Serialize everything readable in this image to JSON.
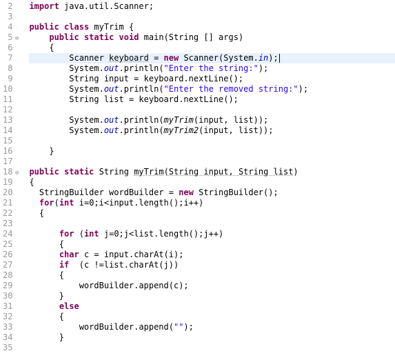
{
  "lines": [
    {
      "num": "2",
      "fold": "",
      "tokens": [
        {
          "cls": "kw",
          "t": "import"
        },
        {
          "cls": "",
          "t": " java.util.Scanner;"
        }
      ]
    },
    {
      "num": "3",
      "fold": "",
      "tokens": [
        {
          "cls": "",
          "t": ""
        }
      ]
    },
    {
      "num": "4",
      "fold": "",
      "tokens": [
        {
          "cls": "kw",
          "t": "public"
        },
        {
          "cls": "",
          "t": " "
        },
        {
          "cls": "kw",
          "t": "class"
        },
        {
          "cls": "",
          "t": " myTrim {"
        }
      ]
    },
    {
      "num": "5",
      "fold": "⊖",
      "tokens": [
        {
          "cls": "",
          "t": "    "
        },
        {
          "cls": "kw",
          "t": "public"
        },
        {
          "cls": "",
          "t": " "
        },
        {
          "cls": "kw",
          "t": "static"
        },
        {
          "cls": "",
          "t": " "
        },
        {
          "cls": "kw",
          "t": "void"
        },
        {
          "cls": "",
          "t": " main(String [] args)"
        }
      ]
    },
    {
      "num": "6",
      "fold": "",
      "tokens": [
        {
          "cls": "",
          "t": "    {"
        }
      ]
    },
    {
      "num": "7",
      "fold": "",
      "highlight": true,
      "cursor": true,
      "tokens": [
        {
          "cls": "",
          "t": "        Scanner "
        },
        {
          "cls": "underline-wavy",
          "t": "keyboard"
        },
        {
          "cls": "",
          "t": " = "
        },
        {
          "cls": "kw",
          "t": "new"
        },
        {
          "cls": "",
          "t": " Scanner(System."
        },
        {
          "cls": "field",
          "t": "in"
        },
        {
          "cls": "",
          "t": ");"
        }
      ]
    },
    {
      "num": "8",
      "fold": "",
      "tokens": [
        {
          "cls": "",
          "t": "        System."
        },
        {
          "cls": "field",
          "t": "out"
        },
        {
          "cls": "",
          "t": ".println("
        },
        {
          "cls": "str",
          "t": "\"Enter the string:\""
        },
        {
          "cls": "",
          "t": ");"
        }
      ]
    },
    {
      "num": "9",
      "fold": "",
      "tokens": [
        {
          "cls": "",
          "t": "        String input = keyboard.nextLine();"
        }
      ]
    },
    {
      "num": "10",
      "fold": "",
      "tokens": [
        {
          "cls": "",
          "t": "        System."
        },
        {
          "cls": "field",
          "t": "out"
        },
        {
          "cls": "",
          "t": ".println("
        },
        {
          "cls": "str",
          "t": "\"Enter the removed string:\""
        },
        {
          "cls": "",
          "t": ");"
        }
      ]
    },
    {
      "num": "11",
      "fold": "",
      "tokens": [
        {
          "cls": "",
          "t": "        String list = keyboard.nextLine();"
        }
      ]
    },
    {
      "num": "12",
      "fold": "",
      "tokens": [
        {
          "cls": "",
          "t": ""
        }
      ]
    },
    {
      "num": "13",
      "fold": "",
      "tokens": [
        {
          "cls": "",
          "t": "        System."
        },
        {
          "cls": "field",
          "t": "out"
        },
        {
          "cls": "",
          "t": ".println("
        },
        {
          "cls": "static-call",
          "t": "myTrim"
        },
        {
          "cls": "",
          "t": "(input, list));"
        }
      ]
    },
    {
      "num": "14",
      "fold": "",
      "tokens": [
        {
          "cls": "",
          "t": "        System."
        },
        {
          "cls": "field",
          "t": "out"
        },
        {
          "cls": "",
          "t": ".println("
        },
        {
          "cls": "static-call",
          "t": "myTrim2"
        },
        {
          "cls": "",
          "t": "(input, list));"
        }
      ]
    },
    {
      "num": "15",
      "fold": "",
      "tokens": [
        {
          "cls": "",
          "t": ""
        }
      ]
    },
    {
      "num": "16",
      "fold": "",
      "tokens": [
        {
          "cls": "",
          "t": "    }"
        }
      ]
    },
    {
      "num": "17",
      "fold": "",
      "tokens": [
        {
          "cls": "",
          "t": ""
        }
      ]
    },
    {
      "num": "18",
      "fold": "⊖",
      "tokens": [
        {
          "cls": "kw",
          "t": "public"
        },
        {
          "cls": "",
          "t": " "
        },
        {
          "cls": "kw",
          "t": "static"
        },
        {
          "cls": "",
          "t": " String "
        },
        {
          "cls": "underline-wavy",
          "t": "myTrim"
        },
        {
          "cls": "",
          "t": "("
        },
        {
          "cls": "underline-wavy",
          "t": "String input, String list"
        },
        {
          "cls": "",
          "t": ")"
        }
      ]
    },
    {
      "num": "19",
      "fold": "",
      "tokens": [
        {
          "cls": "",
          "t": "{"
        }
      ]
    },
    {
      "num": "20",
      "fold": "",
      "tokens": [
        {
          "cls": "",
          "t": "  StringBuilder wordBuilder = "
        },
        {
          "cls": "kw",
          "t": "new"
        },
        {
          "cls": "",
          "t": " StringBuilder();"
        }
      ]
    },
    {
      "num": "21",
      "fold": "",
      "tokens": [
        {
          "cls": "",
          "t": "  "
        },
        {
          "cls": "kw",
          "t": "for"
        },
        {
          "cls": "",
          "t": "("
        },
        {
          "cls": "kw",
          "t": "int"
        },
        {
          "cls": "",
          "t": " i=0;i<input.length();i++)"
        }
      ]
    },
    {
      "num": "22",
      "fold": "",
      "tokens": [
        {
          "cls": "",
          "t": "  {"
        }
      ]
    },
    {
      "num": "23",
      "fold": "",
      "tokens": [
        {
          "cls": "",
          "t": ""
        }
      ]
    },
    {
      "num": "24",
      "fold": "",
      "tokens": [
        {
          "cls": "",
          "t": "      "
        },
        {
          "cls": "kw",
          "t": "for"
        },
        {
          "cls": "",
          "t": " ("
        },
        {
          "cls": "kw",
          "t": "int"
        },
        {
          "cls": "",
          "t": " j=0;j<list.length();j++)"
        }
      ]
    },
    {
      "num": "25",
      "fold": "",
      "tokens": [
        {
          "cls": "",
          "t": "      {"
        }
      ]
    },
    {
      "num": "26",
      "fold": "",
      "tokens": [
        {
          "cls": "",
          "t": "      "
        },
        {
          "cls": "kw",
          "t": "char"
        },
        {
          "cls": "",
          "t": " c = input.charAt(i);"
        }
      ]
    },
    {
      "num": "27",
      "fold": "",
      "tokens": [
        {
          "cls": "",
          "t": "      "
        },
        {
          "cls": "kw",
          "t": "if"
        },
        {
          "cls": "",
          "t": "  (c !=list.charAt(j))"
        }
      ]
    },
    {
      "num": "28",
      "fold": "",
      "tokens": [
        {
          "cls": "",
          "t": "      {"
        }
      ]
    },
    {
      "num": "29",
      "fold": "",
      "tokens": [
        {
          "cls": "",
          "t": "          wordBuilder.append(c);"
        }
      ]
    },
    {
      "num": "30",
      "fold": "",
      "tokens": [
        {
          "cls": "",
          "t": "      }"
        }
      ]
    },
    {
      "num": "31",
      "fold": "",
      "tokens": [
        {
          "cls": "",
          "t": "      "
        },
        {
          "cls": "kw",
          "t": "else"
        }
      ]
    },
    {
      "num": "32",
      "fold": "",
      "tokens": [
        {
          "cls": "",
          "t": "      {"
        }
      ]
    },
    {
      "num": "33",
      "fold": "",
      "tokens": [
        {
          "cls": "",
          "t": "          wordBuilder.append("
        },
        {
          "cls": "str",
          "t": "\"\""
        },
        {
          "cls": "",
          "t": ");"
        }
      ]
    },
    {
      "num": "34",
      "fold": "",
      "tokens": [
        {
          "cls": "",
          "t": "      }"
        }
      ]
    },
    {
      "num": "35",
      "fold": "",
      "tokens": [
        {
          "cls": "",
          "t": ""
        }
      ]
    }
  ]
}
